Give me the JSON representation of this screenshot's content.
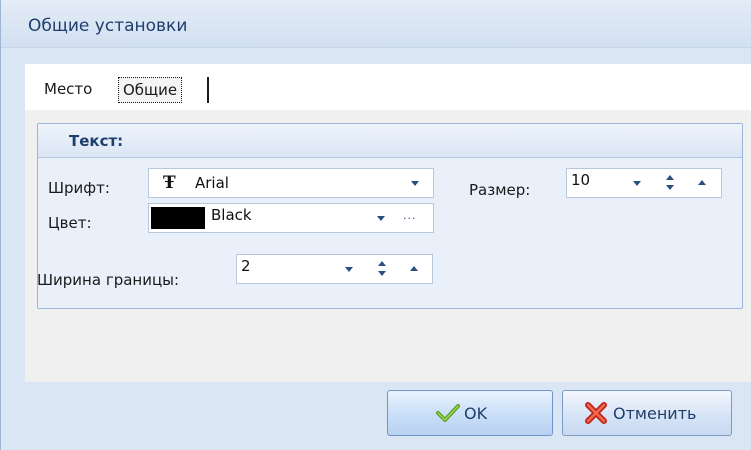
{
  "window": {
    "title": "Общие установки"
  },
  "tabs": [
    {
      "label": "Место",
      "selected": false
    },
    {
      "label": "Общие",
      "selected": true
    }
  ],
  "text_group": {
    "header": "Текст:",
    "font": {
      "label": "Шрифт:",
      "value": "Arial",
      "icon": "font-T-icon"
    },
    "size": {
      "label": "Размер:",
      "value": "10"
    },
    "color": {
      "label": "Цвет:",
      "value": "Black",
      "swatch": "#000000"
    }
  },
  "border_width": {
    "label": "Ширина границы:",
    "value": "2"
  },
  "buttons": {
    "ok": "OK",
    "cancel": "Отменить"
  },
  "colors": {
    "accent": "#1e3f6b",
    "panel": "#dbe6f4",
    "group_border": "#9ab6db"
  }
}
